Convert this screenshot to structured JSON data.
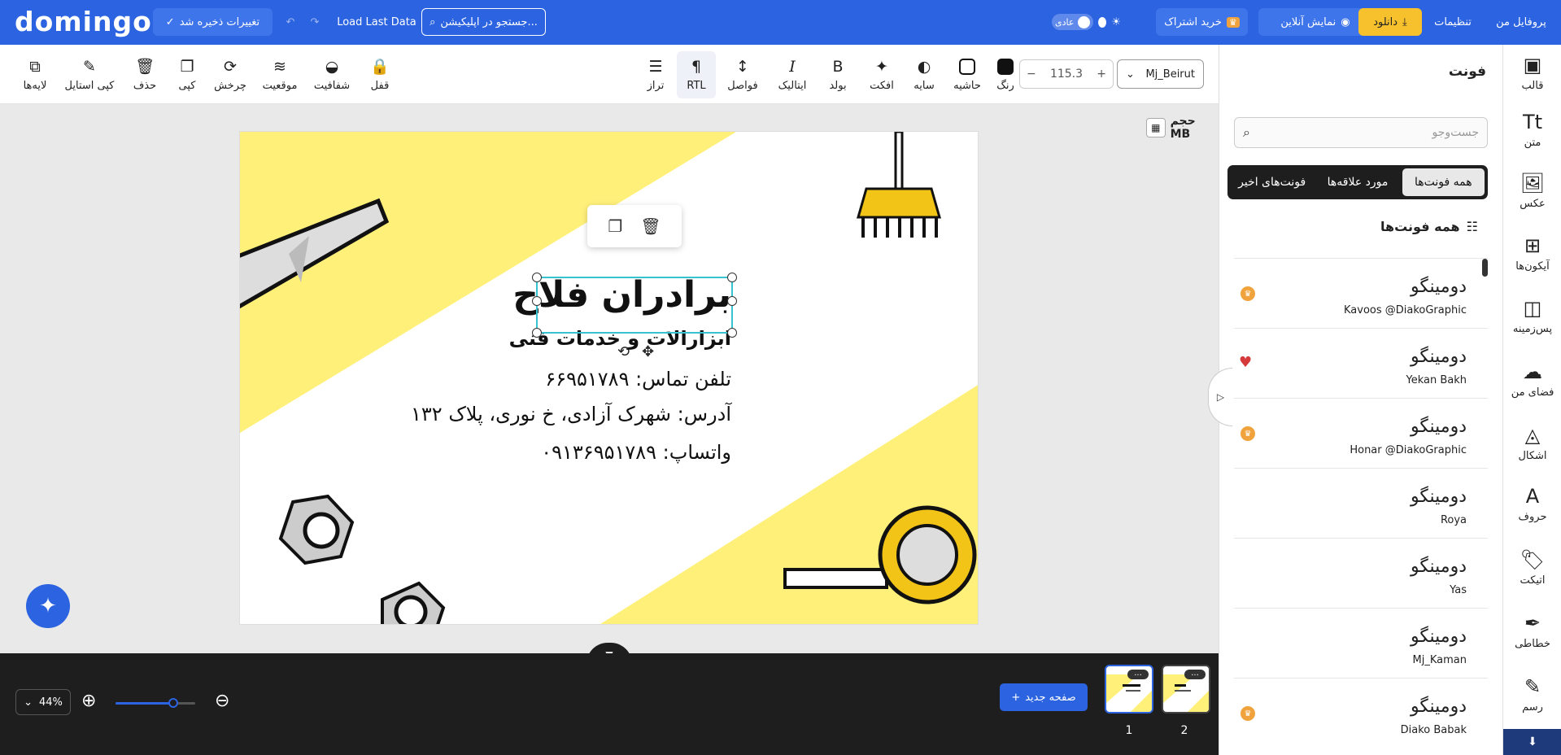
{
  "topbar": {
    "logo": "domingo",
    "save_label": "تغییرات ذخیره شد",
    "load_label": "Load Last Data",
    "search_placeholder": "جستجو در اپلیکیشن...",
    "toggle_label": "عادی",
    "buy_label": "خرید اشتراک",
    "live_label": "نمایش آنلاین",
    "download_label": "دانلود",
    "settings_label": "تنظیمات",
    "profile_label": "پروفایل من"
  },
  "toolbar": {
    "layers": "لایه‌ها",
    "copy_style": "کپی استایل",
    "delete": "حذف",
    "copy": "کپی",
    "rotate": "چرخش",
    "position": "موقعیت",
    "opacity": "شفافیت",
    "lock": "قفل",
    "align": "تراز",
    "rtl": "RTL",
    "spacing": "فواصل",
    "italic": "ایتالیک",
    "bold": "بولد",
    "effect": "افکت",
    "shadow": "سایه",
    "border": "حاشیه",
    "color": "رنگ",
    "font_size": "115.3",
    "font_name": "Mj_Beirut",
    "text_color": "#111111"
  },
  "canvas": {
    "size_label": "حجم MB",
    "title": "برادران فلاح",
    "subtitle": "ابزارالات و خدمات فنی",
    "phone": "تلفن تماس: ۶۶۹۵۱۷۸۹",
    "address": "آدرس: شهرک آزادی، خ نوری، پلاک ۱۳۲",
    "whatsapp": "واتساپ: ۰۹۱۳۶۹۵۱۷۸۹",
    "bg_accent": "#fff07a"
  },
  "bottom": {
    "zoom": "44%",
    "zoom_level": 0.72,
    "new_page": "صفحه جدید",
    "pages": [
      "1",
      "2"
    ],
    "page_menu": "..."
  },
  "panel": {
    "title": "فونت",
    "search_placeholder": "جست‌وجو",
    "tabs": [
      "همه فونت‌ها",
      "مورد علاقه‌ها",
      "فونت‌های اخیر"
    ],
    "section_title": "همه فونت‌ها",
    "fonts": [
      {
        "preview": "دومینگو",
        "name": "Kavoos @DiakoGraphic",
        "mark": "pro"
      },
      {
        "preview": "دومینگو",
        "name": "Yekan Bakh",
        "mark": "fav"
      },
      {
        "preview": "دومینگو",
        "name": "Honar @DiakoGraphic",
        "mark": "pro"
      },
      {
        "preview": "دومینگو",
        "name": "Roya",
        "mark": ""
      },
      {
        "preview": "دومینگو",
        "name": "Yas",
        "mark": ""
      },
      {
        "preview": "دومینگو",
        "name": "Mj_Kaman",
        "mark": ""
      },
      {
        "preview": "دومینگو",
        "name": "Diako Babak",
        "mark": "pro"
      }
    ]
  },
  "sidebar": {
    "items": [
      "قالب",
      "متن",
      "عکس",
      "آیکون‌ها",
      "پس‌زمینه",
      "فضای من",
      "اشکال",
      "حروف",
      "اتیکت",
      "خطاطی",
      "رسم"
    ]
  },
  "colors": {
    "primary": "#2b63e0",
    "dark": "#1e1e1e",
    "yellow": "#f7c12d",
    "selection": "#36c2cf"
  }
}
